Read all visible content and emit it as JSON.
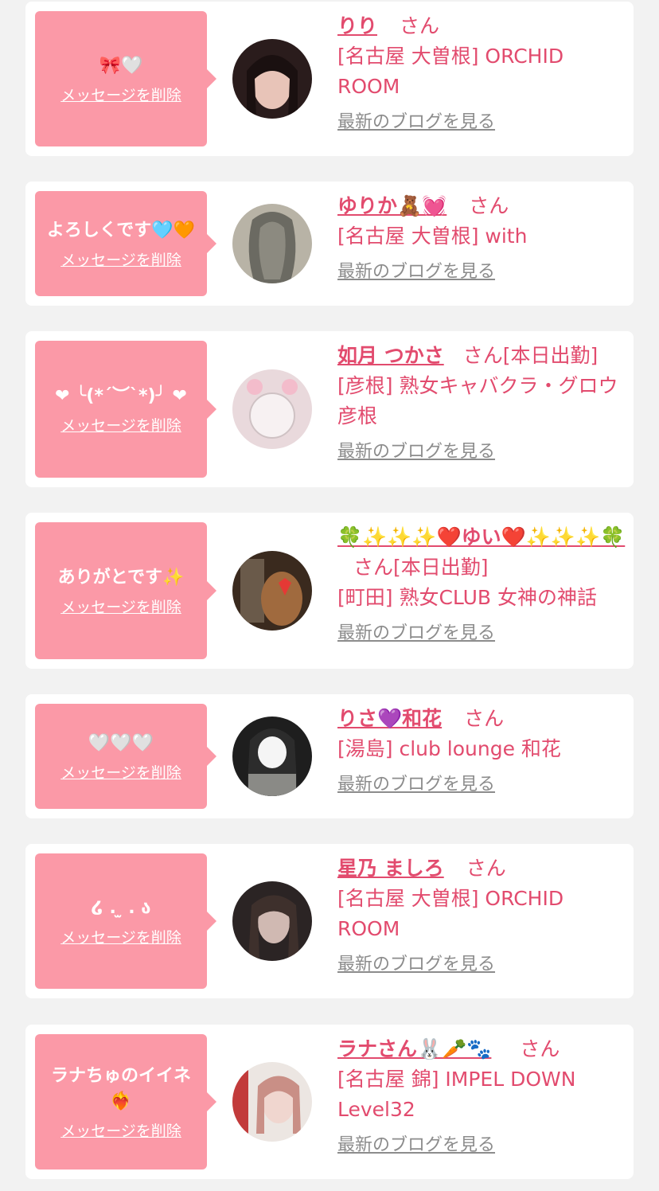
{
  "messages": [
    {
      "message": "🎀🤍",
      "delete_label": "メッセージを削除",
      "name": "りり",
      "honorific": "さん",
      "shop": "[名古屋 大曽根] ORCHID ROOM",
      "blog_link": "最新のブログを見る",
      "avatar_colors": [
        "#2a1c1c",
        "#e8c4b8"
      ]
    },
    {
      "message": "よろしくです🩵🧡",
      "delete_label": "メッセージを削除",
      "name": "ゆりか🧸💓",
      "honorific": "さん",
      "shop": "[名古屋 大曽根] with",
      "blog_link": "最新のブログを見る",
      "avatar_colors": [
        "#6b6a62",
        "#b8b3a6"
      ]
    },
    {
      "message": "❤︎ ╰(*´︶`*)╯ ❤︎",
      "delete_label": "メッセージを削除",
      "name": "如月 つかさ",
      "honorific": "さん[本日出勤]",
      "shop": "[彦根] 熟女キャバクラ・グロウ彦根",
      "blog_link": "最新のブログを見る",
      "avatar_colors": [
        "#e9d9dc",
        "#f7f1f2"
      ]
    },
    {
      "message": "ありがとです✨",
      "delete_label": "メッセージを削除",
      "name": "🍀✨✨✨❤️ゆい❤️✨✨✨🍀",
      "honorific": "さん[本日出勤]",
      "shop": "[町田] 熟女CLUB 女神の神話",
      "blog_link": "最新のブログを見る",
      "avatar_colors": [
        "#3a2a1e",
        "#a06a3e"
      ]
    },
    {
      "message": "🤍🤍🤍",
      "delete_label": "メッセージを削除",
      "name": "りさ💜和花",
      "honorific": "さん",
      "shop": "[湯島] club lounge 和花",
      "blog_link": "最新のブログを見る",
      "avatar_colors": [
        "#1e1e1e",
        "#8a8a86"
      ]
    },
    {
      "message": "໒ . ̫ . ა",
      "delete_label": "メッセージを削除",
      "name": "星乃 ましろ",
      "honorific": "さん",
      "shop": "[名古屋 大曽根] ORCHID ROOM",
      "blog_link": "最新のブログを見る",
      "avatar_colors": [
        "#2b2424",
        "#d0b9b2"
      ]
    },
    {
      "message": "ラナちゅのイイネ❤️‍🔥",
      "delete_label": "メッセージを削除",
      "name": "ラナさん🐰🥕🐾",
      "honorific": "さん",
      "shop": "[名古屋 錦] IMPEL DOWN Level32",
      "blog_link": "最新のブログを見る",
      "avatar_colors": [
        "#ece6e2",
        "#c98f86"
      ]
    }
  ]
}
